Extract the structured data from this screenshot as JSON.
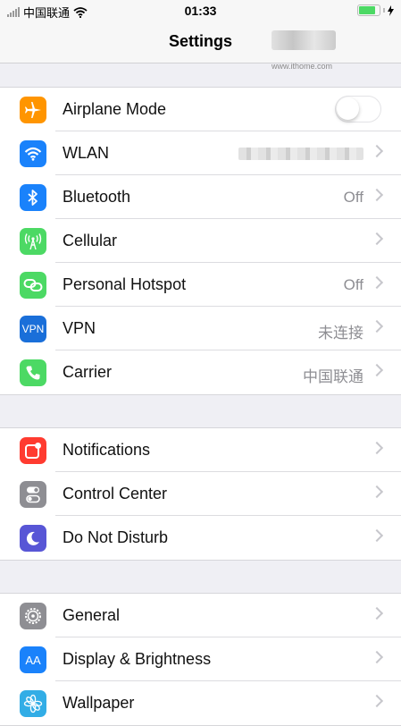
{
  "status_bar": {
    "carrier": "中国联通",
    "time": "01:33"
  },
  "nav": {
    "title": "Settings",
    "watermark": "www.ithome.com"
  },
  "groups": [
    {
      "rows": [
        {
          "label": "Airplane Mode",
          "icon": "airplane-icon",
          "color": "#ff9500",
          "toggle": false
        },
        {
          "label": "WLAN",
          "icon": "wifi-icon",
          "color": "#1a82fb",
          "value_blurred": true
        },
        {
          "label": "Bluetooth",
          "icon": "bluetooth-icon",
          "color": "#1a82fb",
          "value": "Off"
        },
        {
          "label": "Cellular",
          "icon": "antenna-icon",
          "color": "#4cd964"
        },
        {
          "label": "Personal Hotspot",
          "icon": "hotspot-icon",
          "color": "#4cd964",
          "value": "Off"
        },
        {
          "label": "VPN",
          "icon": "vpn-icon",
          "color": "#1a6fd9",
          "icon_text": "VPN",
          "value": "未连接"
        },
        {
          "label": "Carrier",
          "icon": "phone-icon",
          "color": "#4cd964",
          "value": "中国联通"
        }
      ]
    },
    {
      "rows": [
        {
          "label": "Notifications",
          "icon": "notifications-icon",
          "color": "#ff3b30"
        },
        {
          "label": "Control Center",
          "icon": "control-center-icon",
          "color": "#8e8e93"
        },
        {
          "label": "Do Not Disturb",
          "icon": "moon-icon",
          "color": "#5856d6"
        }
      ]
    },
    {
      "rows": [
        {
          "label": "General",
          "icon": "gear-icon",
          "color": "#8e8e93"
        },
        {
          "label": "Display & Brightness",
          "icon": "display-icon",
          "color": "#1a82fb",
          "icon_text": "AA"
        },
        {
          "label": "Wallpaper",
          "icon": "flower-icon",
          "color": "#32ade6"
        }
      ]
    }
  ]
}
